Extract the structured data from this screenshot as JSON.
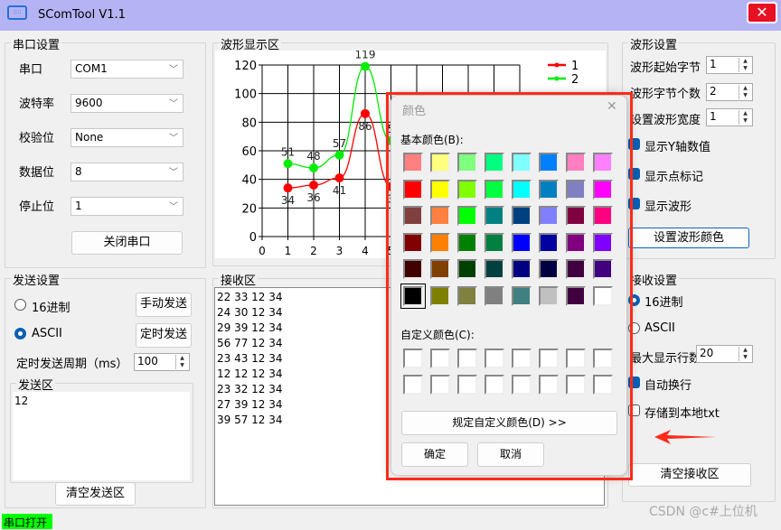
{
  "window": {
    "title": "SComTool V1.1",
    "close_icon": "close-icon"
  },
  "serial": {
    "title": "串口设置",
    "fields": [
      {
        "label": "串口",
        "value": "COM1"
      },
      {
        "label": "波特率",
        "value": "9600"
      },
      {
        "label": "校验位",
        "value": "None"
      },
      {
        "label": "数据位",
        "value": "8"
      },
      {
        "label": "停止位",
        "value": "1"
      }
    ],
    "toggle_button": "关闭串口"
  },
  "wave_area": {
    "title": "波形显示区"
  },
  "chart_data": {
    "type": "line",
    "x_ticks": [
      "0",
      "1",
      "2",
      "3",
      "4",
      "5"
    ],
    "y_ticks": [
      "0",
      "20",
      "40",
      "60",
      "80",
      "100",
      "120"
    ],
    "xlim": [
      0,
      10
    ],
    "ylim": [
      0,
      120
    ],
    "grid": true,
    "legend_placement": "top-right",
    "series": [
      {
        "name": "1",
        "color": "#ff0000",
        "x": [
          1,
          2,
          3,
          4,
          5
        ],
        "values": [
          34,
          36,
          41,
          86,
          35
        ],
        "labels": [
          "34",
          "36",
          "41",
          "86",
          "3"
        ]
      },
      {
        "name": "2",
        "color": "#00ee00",
        "x": [
          1,
          2,
          3,
          4,
          5
        ],
        "values": [
          51,
          48,
          57,
          119,
          67
        ],
        "labels": [
          "51",
          "48",
          "57",
          "119",
          "5"
        ]
      }
    ]
  },
  "wave_settings": {
    "title": "波形设置",
    "start_byte_label": "波形起始字节",
    "start_byte": "1",
    "byte_count_label": "波形字节个数",
    "byte_count": "2",
    "width_label": "设置波形宽度",
    "width": "1",
    "checks": [
      {
        "label": "显示Y轴数值",
        "checked": true
      },
      {
        "label": "显示点标记",
        "checked": true
      },
      {
        "label": "显示波形",
        "checked": true
      }
    ],
    "color_button": "设置波形颜色"
  },
  "send": {
    "title": "发送设置",
    "hex_label": "16进制",
    "ascii_label": "ASCII",
    "mode": "ASCII",
    "manual_button": "手动发送",
    "timer_button": "定时发送",
    "period_label": "定时发送周期（ms）",
    "period": "100",
    "area_title": "发送区",
    "text": "12",
    "clear_button": "清空发送区"
  },
  "receive": {
    "title": "接收区",
    "lines": [
      "22 33 12 34",
      "24 30 12 34",
      "29 39 12 34",
      "56 77 12 34",
      "23 43 12 34",
      "12 12 12 34",
      "23 32 12 34",
      "27 39 12 34",
      "39 57 12 34"
    ]
  },
  "recv_settings": {
    "title": "接收设置",
    "hex_label": "16进制",
    "ascii_label": "ASCII",
    "mode": "16进制",
    "max_lines_label": "最大显示行数",
    "max_lines": "20",
    "wrap_label": "自动换行",
    "wrap": true,
    "save_label": "存储到本地txt",
    "save": false,
    "clear_button": "清空接收区"
  },
  "status": {
    "text": "串口打开",
    "color": "#00ff00"
  },
  "color_dialog": {
    "title": "颜色",
    "basic_label": "基本颜色(B):",
    "custom_label": "自定义颜色(C):",
    "define_button": "规定自定义颜色(D) >>",
    "ok": "确定",
    "cancel": "取消",
    "selected": "#000000",
    "basic_colors": [
      "#FF8080",
      "#FFFF80",
      "#80FF80",
      "#00FF80",
      "#80FFFF",
      "#0080FF",
      "#FF80C0",
      "#FF80FF",
      "#FF0000",
      "#FFFF00",
      "#80FF00",
      "#00FF40",
      "#00FFFF",
      "#0080C0",
      "#8080C0",
      "#FF00FF",
      "#804040",
      "#FF8040",
      "#00FF00",
      "#008080",
      "#004080",
      "#8080FF",
      "#800040",
      "#FF0080",
      "#800000",
      "#FF8000",
      "#008000",
      "#008040",
      "#0000FF",
      "#0000A0",
      "#800080",
      "#8000FF",
      "#400000",
      "#804000",
      "#004000",
      "#004040",
      "#000080",
      "#000040",
      "#400040",
      "#400080",
      "#000000",
      "#808000",
      "#808040",
      "#808080",
      "#408080",
      "#C0C0C0",
      "#400040",
      "#FFFFFF"
    ]
  },
  "annotation": {
    "highlight_color": "#ff2a1a"
  },
  "watermark": "CSDN @c#上位机"
}
